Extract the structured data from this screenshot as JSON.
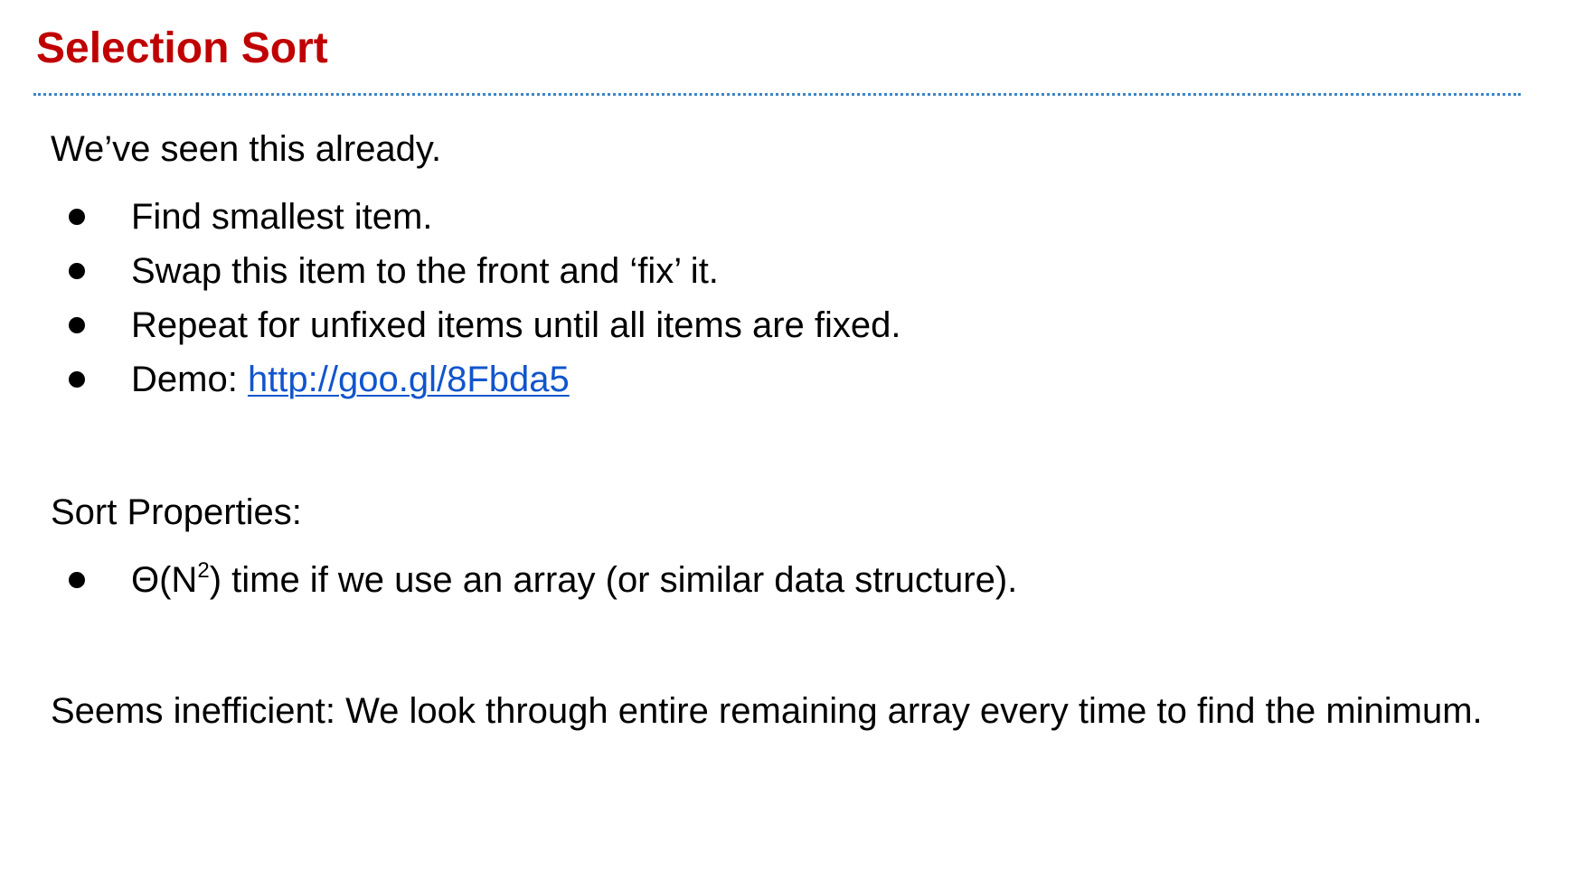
{
  "title": "Selection Sort",
  "intro": "We’ve seen this already.",
  "steps": [
    "Find smallest item.",
    "Swap this item to the front and ‘fix’ it.",
    "Repeat for unfixed items until all items are fixed."
  ],
  "demo": {
    "label": "Demo: ",
    "link_text": "http://goo.gl/8Fbda5"
  },
  "properties": {
    "heading": "Sort Properties:",
    "complexity": {
      "prefix": "Θ(N",
      "exponent": "2",
      "suffix": ") time if we use an array (or similar data structure)."
    }
  },
  "conclusion": "Seems inefficient: We look through entire remaining array every time to find the minimum.",
  "colors": {
    "title": "#c00000",
    "rule": "#3d85c6",
    "link": "#1155cc"
  }
}
